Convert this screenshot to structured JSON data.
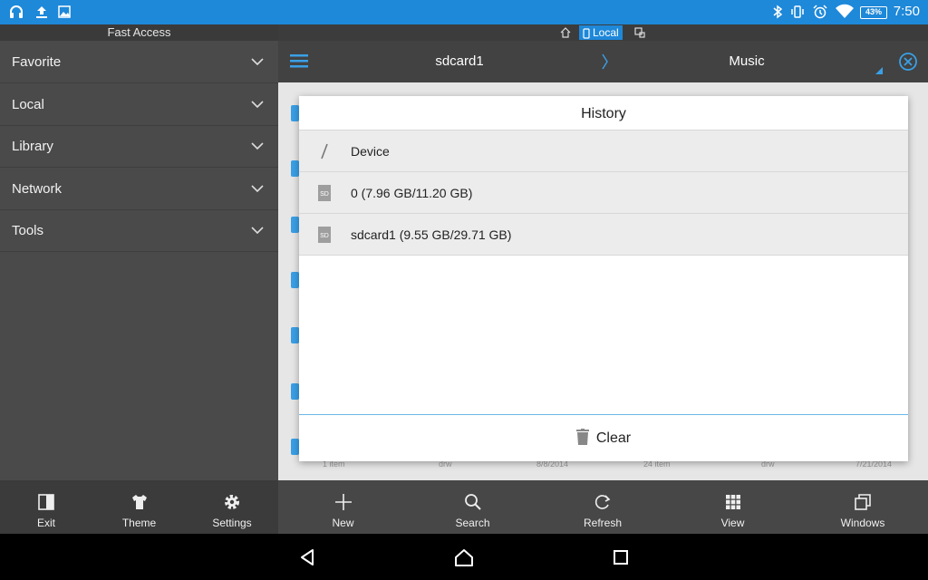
{
  "status_bar": {
    "time": "7:50",
    "battery": "43%",
    "left_icons": [
      "headphones-icon",
      "upload-icon",
      "image-icon"
    ],
    "right_icons": [
      "bluetooth-icon",
      "vibrate-icon",
      "alarm-icon",
      "wifi-icon"
    ]
  },
  "drawer": {
    "header": "Fast Access",
    "items": [
      {
        "label": "Favorite"
      },
      {
        "label": "Local"
      },
      {
        "label": "Library"
      },
      {
        "label": "Network"
      },
      {
        "label": "Tools"
      }
    ],
    "bottom": [
      {
        "label": "Exit",
        "icon": "exit-icon"
      },
      {
        "label": "Theme",
        "icon": "shirt-icon"
      },
      {
        "label": "Settings",
        "icon": "gear-icon"
      }
    ]
  },
  "window_tabs": {
    "active": "Local"
  },
  "path": {
    "segments": [
      "sdcard1",
      "Music"
    ]
  },
  "dialog": {
    "title": "History",
    "rows": [
      {
        "label": "Device",
        "icon": "slash-icon"
      },
      {
        "label": "0 (7.96 GB/11.20 GB)",
        "icon": "sd-card-icon"
      },
      {
        "label": "sdcard1 (9.55 GB/29.71 GB)",
        "icon": "sd-card-icon"
      }
    ],
    "clear_label": "Clear",
    "sd_badge": "SD"
  },
  "background_meta": {
    "row_left": [
      "1 item",
      "drw",
      "8/8/2014"
    ],
    "row_right": [
      "24 item",
      "drw",
      "7/21/2014"
    ]
  },
  "toolbar": {
    "items": [
      {
        "label": "New",
        "icon": "plus-icon"
      },
      {
        "label": "Search",
        "icon": "search-icon"
      },
      {
        "label": "Refresh",
        "icon": "refresh-icon"
      },
      {
        "label": "View",
        "icon": "grid-icon"
      },
      {
        "label": "Windows",
        "icon": "windows-icon"
      }
    ]
  },
  "colors": {
    "accent": "#1e88d9",
    "drawer_bg": "#4a4a4a",
    "toolbar_bg": "#424242"
  }
}
